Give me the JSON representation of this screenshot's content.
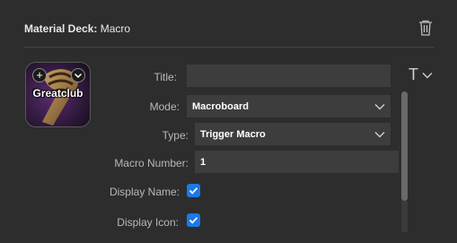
{
  "header": {
    "plugin": "Material Deck:",
    "action": "Macro"
  },
  "key": {
    "title": "Greatclub"
  },
  "form": {
    "title_label": "Title:",
    "title_value": "",
    "mode_label": "Mode:",
    "mode_value": "Macroboard",
    "type_label": "Type:",
    "type_value": "Trigger Macro",
    "macro_number_label": "Macro Number:",
    "macro_number_value": "1",
    "display_name_label": "Display Name:",
    "display_name_checked": true,
    "display_icon_label": "Display Icon:",
    "display_icon_checked": true
  },
  "text_tool": {
    "glyph": "T"
  },
  "colors": {
    "accent": "#1a7ae6",
    "background": "#2d2d2d",
    "field": "#3d3d3d"
  },
  "icons": [
    "trash-icon",
    "plus-icon",
    "chevron-down-icon",
    "checkmark-icon",
    "text-format-icon"
  ]
}
